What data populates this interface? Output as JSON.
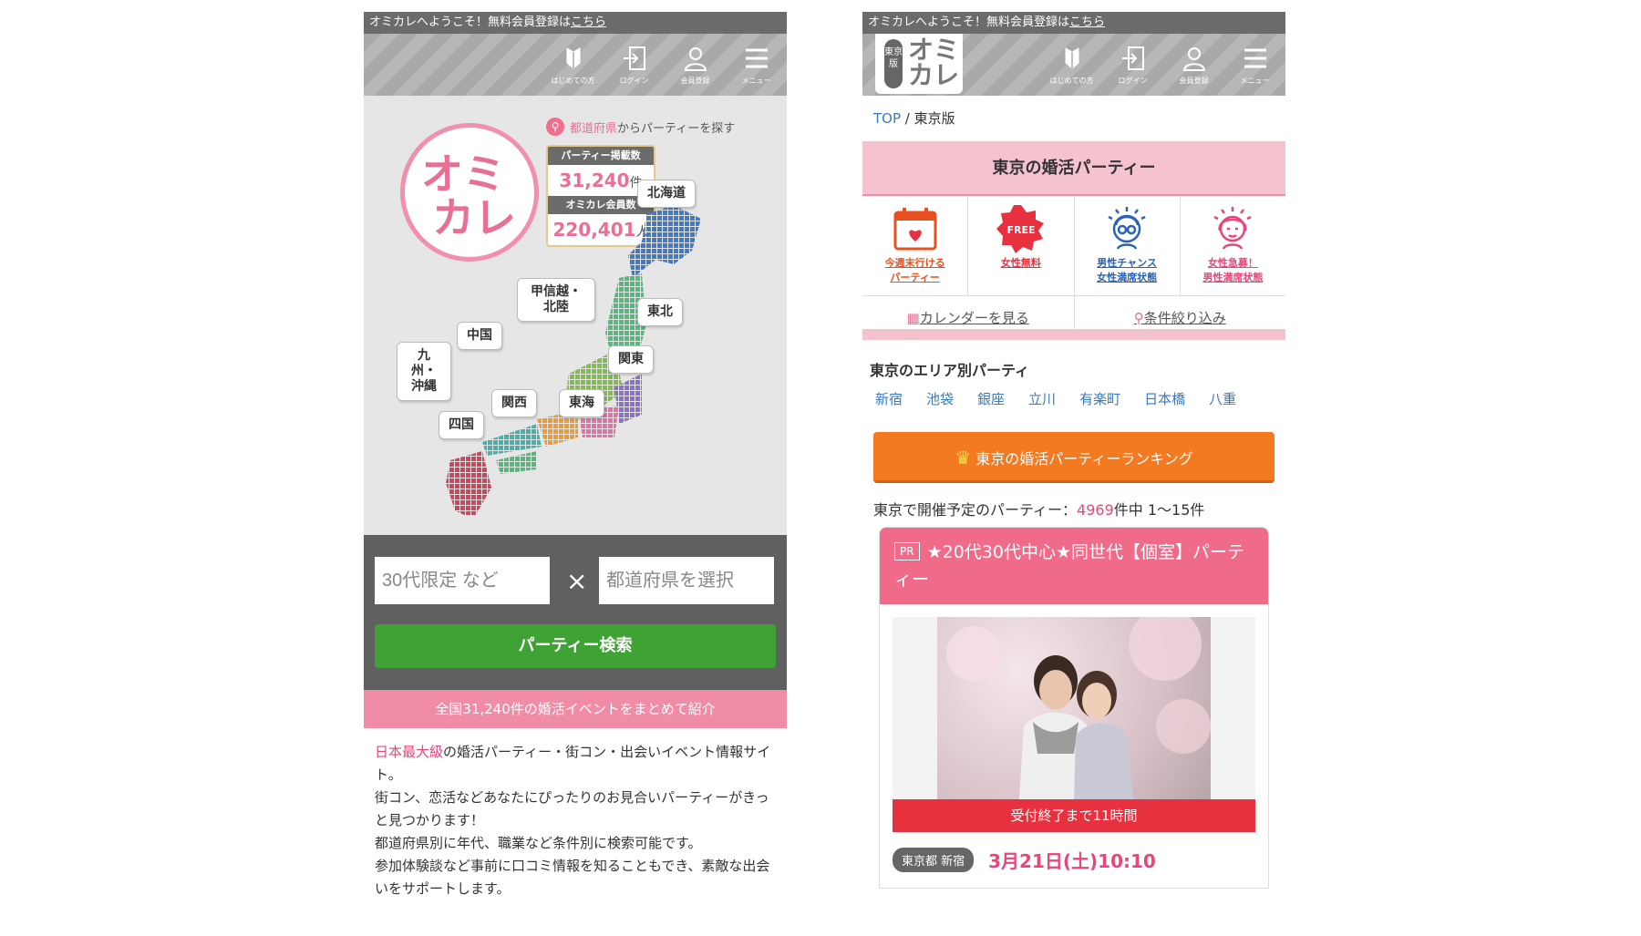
{
  "common": {
    "welcome": "オミカレへようこそ！無料会員登録は",
    "welcome_link": "こちら",
    "nav": [
      {
        "label": "はじめての方",
        "icon": "beginner-icon"
      },
      {
        "label": "ログイン",
        "icon": "login-icon"
      },
      {
        "label": "会員登録",
        "icon": "user-icon"
      },
      {
        "label": "メニュー",
        "icon": "menu-icon"
      }
    ]
  },
  "left": {
    "logo_line1": "オミ",
    "logo_line2": "カレ",
    "search_pref_hl": "都道府県",
    "search_pref_rest": "からパーティーを探す",
    "stat1_label": "パーティー掲載数",
    "stat1_value": "31,240",
    "stat1_unit": "件",
    "stat2_label": "オミカレ会員数",
    "stat2_value": "220,401",
    "stat2_unit": "人",
    "regions": [
      "北海道",
      "東北",
      "甲信越・北陸",
      "関東",
      "中国",
      "東海",
      "関西",
      "九州・沖縄",
      "四国"
    ],
    "keyword_placeholder": "30代限定 など",
    "pref_placeholder": "都道府県を選択",
    "times": "×",
    "search_button": "パーティー検索",
    "banner": "全国31,240件の婚活イベントをまとめて紹介",
    "intro_hl": "日本最大級",
    "intro_1": "の婚活パーティー・街コン・出会いイベント情報サイト。",
    "intro_2": "街コン、恋活などあなたにぴったりのお見合いパーティーがきっと見つかります！",
    "intro_3": "都道府県別に年代、職業など条件別に検索可能です。",
    "intro_4": "参加体験談など事前に口コミ情報を知ることもでき、素敵な出会いをサポートします。"
  },
  "right": {
    "logo_tag": "東京版",
    "logo_text": "オミカレ",
    "breadcrumb_top": "TOP",
    "breadcrumb_sep": "/",
    "breadcrumb_current": "東京版",
    "title": "東京の婚活パーティー",
    "features": [
      {
        "label": "今週末行ける\nパーティー",
        "color": "#e8511f"
      },
      {
        "label": "女性無料",
        "color": "#e8313e"
      },
      {
        "label": "男性チャンス\n女性満席状態",
        "color": "#2b63b4"
      },
      {
        "label": "女性急募！\n男性満席状態",
        "color": "#e8457a"
      }
    ],
    "calendar_link": "カレンダーを見る",
    "filter_link": "条件絞り込み",
    "area_title": "東京のエリア別パーティ",
    "areas": [
      "新宿",
      "池袋",
      "銀座",
      "立川",
      "有楽町",
      "日本橋",
      "八重"
    ],
    "ranking_button": "東京の婚活パーティーランキング",
    "count_prefix": "東京で開催予定のパーティー：",
    "count_number": "4969",
    "count_suffix": "件中 1〜15件",
    "card_pr": "PR",
    "card_title": "★20代30代中心★同世代【個室】パーティー",
    "deadline": "受付終了まで11時間",
    "location": "東京都 新宿",
    "date": "3月21日(土)10:10"
  },
  "colors": {
    "pink": "#f18ca7",
    "green": "#3ea234",
    "orange": "#f47a22",
    "red": "#e8313e"
  }
}
